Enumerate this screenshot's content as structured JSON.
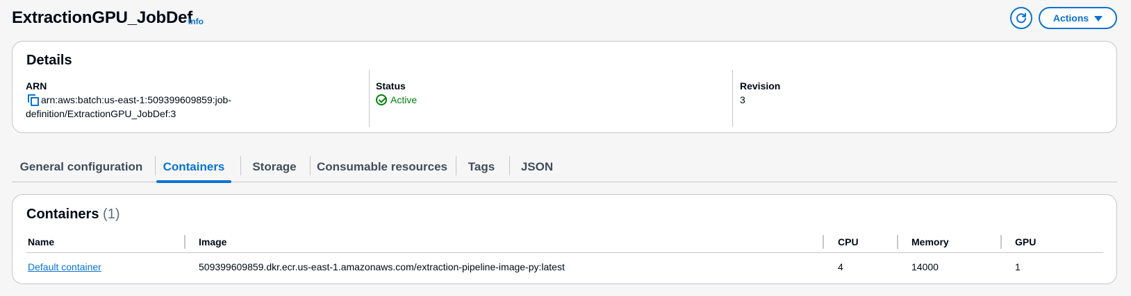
{
  "header": {
    "title": "ExtractionGPU_JobDef",
    "info_label": "Info",
    "actions_label": "Actions"
  },
  "details": {
    "title": "Details",
    "arn_label": "ARN",
    "arn_line1": "arn:aws:batch:us-east-1:509399609859:job-",
    "arn_line2": "definition/ExtractionGPU_JobDef:3",
    "status_label": "Status",
    "status_value": "Active",
    "revision_label": "Revision",
    "revision_value": "3"
  },
  "tabs": [
    {
      "label": "General configuration"
    },
    {
      "label": "Containers"
    },
    {
      "label": "Storage"
    },
    {
      "label": "Consumable resources"
    },
    {
      "label": "Tags"
    },
    {
      "label": "JSON"
    }
  ],
  "containers": {
    "title": "Containers",
    "count": "(1)",
    "columns": [
      "Name",
      "Image",
      "CPU",
      "Memory",
      "GPU"
    ],
    "rows": [
      {
        "name": "Default container",
        "image": "509399609859.dkr.ecr.us-east-1.amazonaws.com/extraction-pipeline-image-py:latest",
        "cpu": "4",
        "memory": "14000",
        "gpu": "1"
      }
    ]
  },
  "colors": {
    "accent": "#0972d3",
    "success": "#037f0c",
    "border": "#c6c6cd",
    "background": "#f6f6f7"
  }
}
